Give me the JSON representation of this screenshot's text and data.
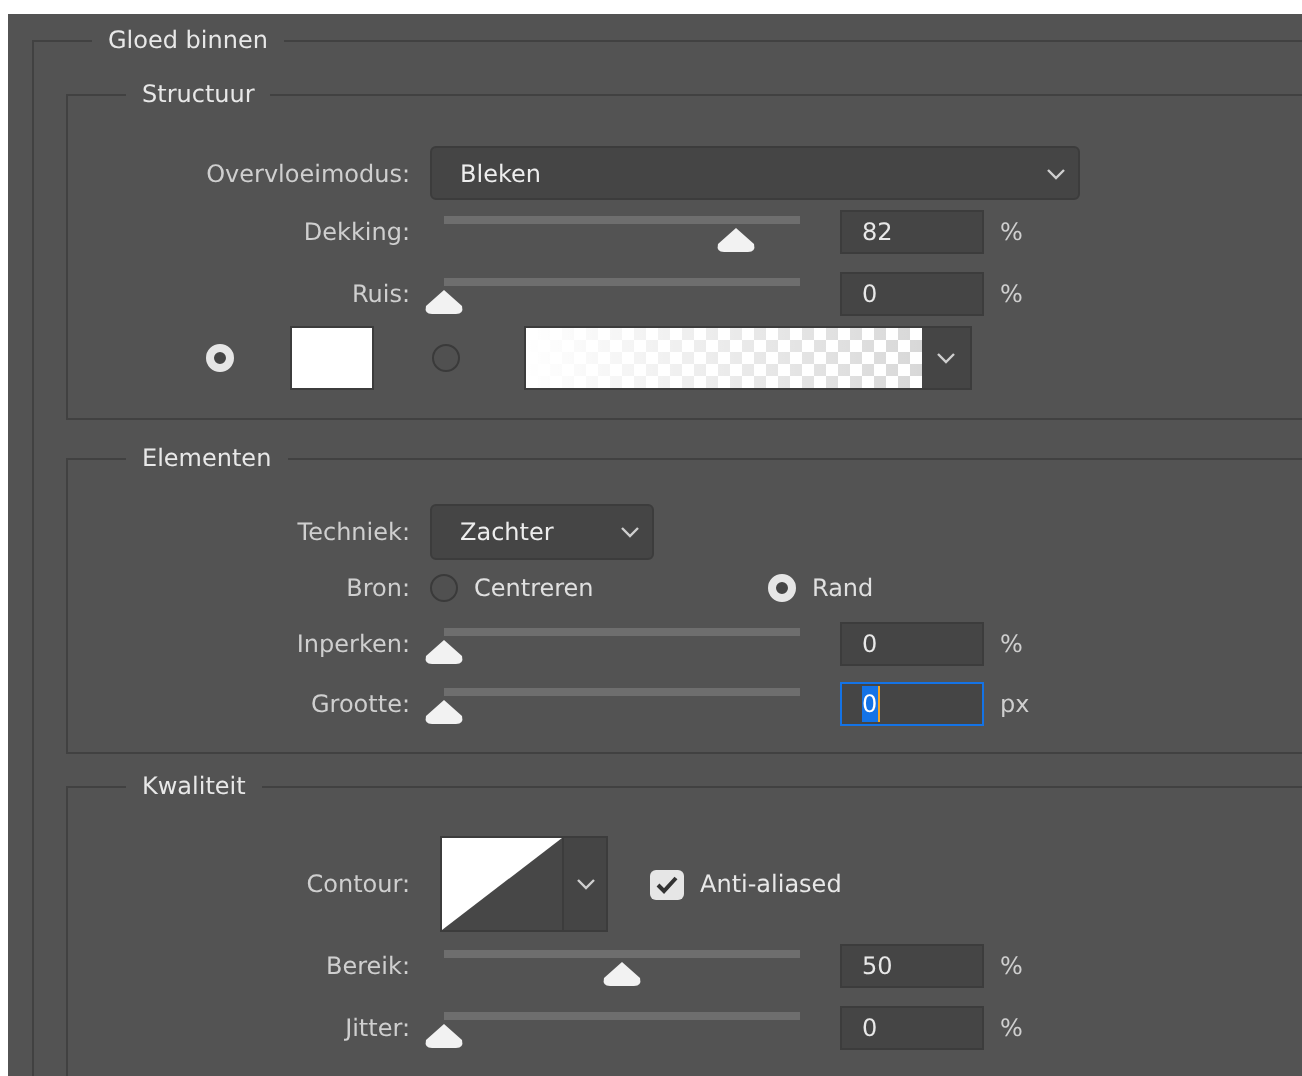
{
  "panel": {
    "title": "Gloed binnen"
  },
  "structure": {
    "title": "Structuur",
    "blend_mode": {
      "label": "Overvloeimodus:",
      "value": "Bleken"
    },
    "sliders": [
      {
        "label": "Dekking:",
        "level": 0.82,
        "value": "82",
        "unit": "%",
        "focused": false
      },
      {
        "label": "Ruis:",
        "level": 0,
        "value": "0",
        "unit": "%",
        "focused": false
      }
    ],
    "fill_options": [
      {
        "kind": "color",
        "selected": true
      },
      {
        "kind": "gradient",
        "selected": false
      }
    ]
  },
  "elements": {
    "title": "Elementen",
    "technique": {
      "label": "Techniek:",
      "value": "Zachter"
    },
    "source": {
      "label": "Bron:",
      "options": [
        {
          "label": "Centreren",
          "selected": false
        },
        {
          "label": "Rand",
          "selected": true
        }
      ]
    },
    "sliders": [
      {
        "label": "Inperken:",
        "level": 0,
        "value": "0",
        "unit": "%",
        "focused": false
      },
      {
        "label": "Grootte:",
        "level": 0,
        "value": "0",
        "unit": "px",
        "focused": true
      }
    ]
  },
  "quality": {
    "title": "Kwaliteit",
    "contour": {
      "label": "Contour:"
    },
    "anti_aliased": {
      "label": "Anti-aliased",
      "checked": true
    },
    "sliders": [
      {
        "label": "Bereik:",
        "level": 0.5,
        "value": "50",
        "unit": "%",
        "focused": false
      },
      {
        "label": "Jitter:",
        "level": 0,
        "value": "0",
        "unit": "%",
        "focused": false
      }
    ]
  }
}
